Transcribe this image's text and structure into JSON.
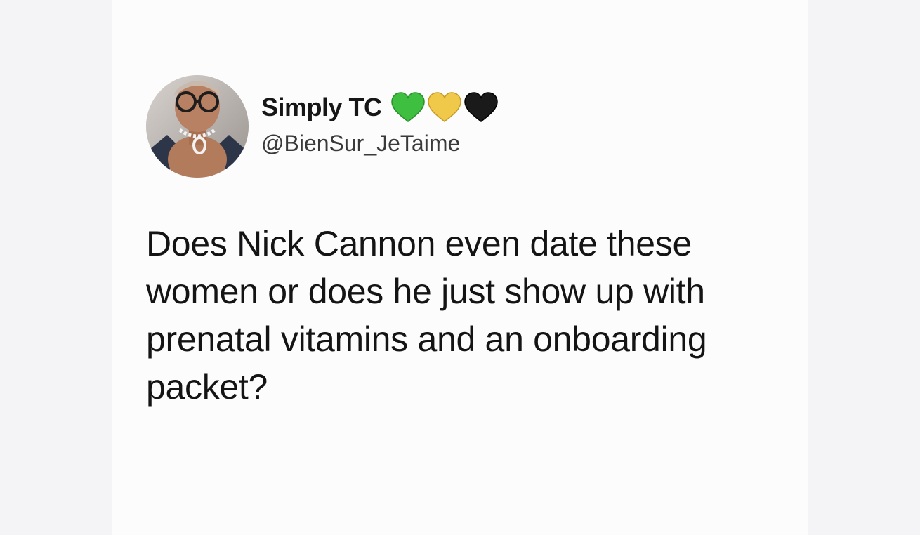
{
  "tweet": {
    "author": {
      "display_name": "Simply TC",
      "handle": "@BienSur_JeTaime",
      "avatar_icon": "profile-photo",
      "name_emojis": [
        {
          "icon": "green-heart-icon",
          "color": "#3fbf3f"
        },
        {
          "icon": "yellow-heart-icon",
          "color": "#f1c94a"
        },
        {
          "icon": "black-heart-icon",
          "color": "#1a1a1a"
        }
      ]
    },
    "text_lines": [
      "Does Nick Cannon even date these",
      "women or does he just show up with",
      "prenatal vitamins and an onboarding",
      "packet?"
    ]
  }
}
